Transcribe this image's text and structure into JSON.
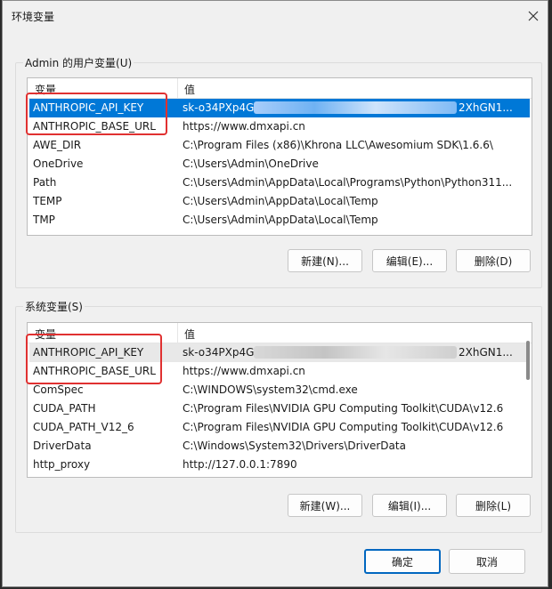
{
  "window": {
    "title": "环境变量",
    "close_icon": "close-icon"
  },
  "user_group": {
    "legend": "Admin 的用户变量(U)",
    "columns": [
      "变量",
      "值"
    ],
    "rows": [
      {
        "name": "ANTHROPIC_API_KEY",
        "value_prefix": "sk-o34PXp4G",
        "value_suffix": "2XhGN1...",
        "selected": true
      },
      {
        "name": "ANTHROPIC_BASE_URL",
        "value": "https://www.dmxapi.cn"
      },
      {
        "name": "AWE_DIR",
        "value": "C:\\Program Files (x86)\\Khrona LLC\\Awesomium SDK\\1.6.6\\"
      },
      {
        "name": "OneDrive",
        "value": "C:\\Users\\Admin\\OneDrive"
      },
      {
        "name": "Path",
        "value": "C:\\Users\\Admin\\AppData\\Local\\Programs\\Python\\Python311..."
      },
      {
        "name": "TEMP",
        "value": "C:\\Users\\Admin\\AppData\\Local\\Temp"
      },
      {
        "name": "TMP",
        "value": "C:\\Users\\Admin\\AppData\\Local\\Temp"
      }
    ],
    "buttons": {
      "new": "新建(N)...",
      "edit": "编辑(E)...",
      "delete": "删除(D)"
    }
  },
  "system_group": {
    "legend": "系统变量(S)",
    "columns": [
      "变量",
      "值"
    ],
    "rows": [
      {
        "name": "ANTHROPIC_API_KEY",
        "value_prefix": "sk-o34PXp4G",
        "value_suffix": "2XhGN1...",
        "focused": true
      },
      {
        "name": "ANTHROPIC_BASE_URL",
        "value": "https://www.dmxapi.cn"
      },
      {
        "name": "ComSpec",
        "value": "C:\\WINDOWS\\system32\\cmd.exe"
      },
      {
        "name": "CUDA_PATH",
        "value": "C:\\Program Files\\NVIDIA GPU Computing Toolkit\\CUDA\\v12.6"
      },
      {
        "name": "CUDA_PATH_V12_6",
        "value": "C:\\Program Files\\NVIDIA GPU Computing Toolkit\\CUDA\\v12.6"
      },
      {
        "name": "DriverData",
        "value": "C:\\Windows\\System32\\Drivers\\DriverData"
      },
      {
        "name": "http_proxy",
        "value": "http://127.0.0.1:7890"
      }
    ],
    "buttons": {
      "new": "新建(W)...",
      "edit": "编辑(I)...",
      "delete": "删除(L)"
    }
  },
  "footer": {
    "ok": "确定",
    "cancel": "取消"
  },
  "colors": {
    "selection": "#0078d7",
    "annotation": "#e03131",
    "primary_border": "#0067c0"
  }
}
